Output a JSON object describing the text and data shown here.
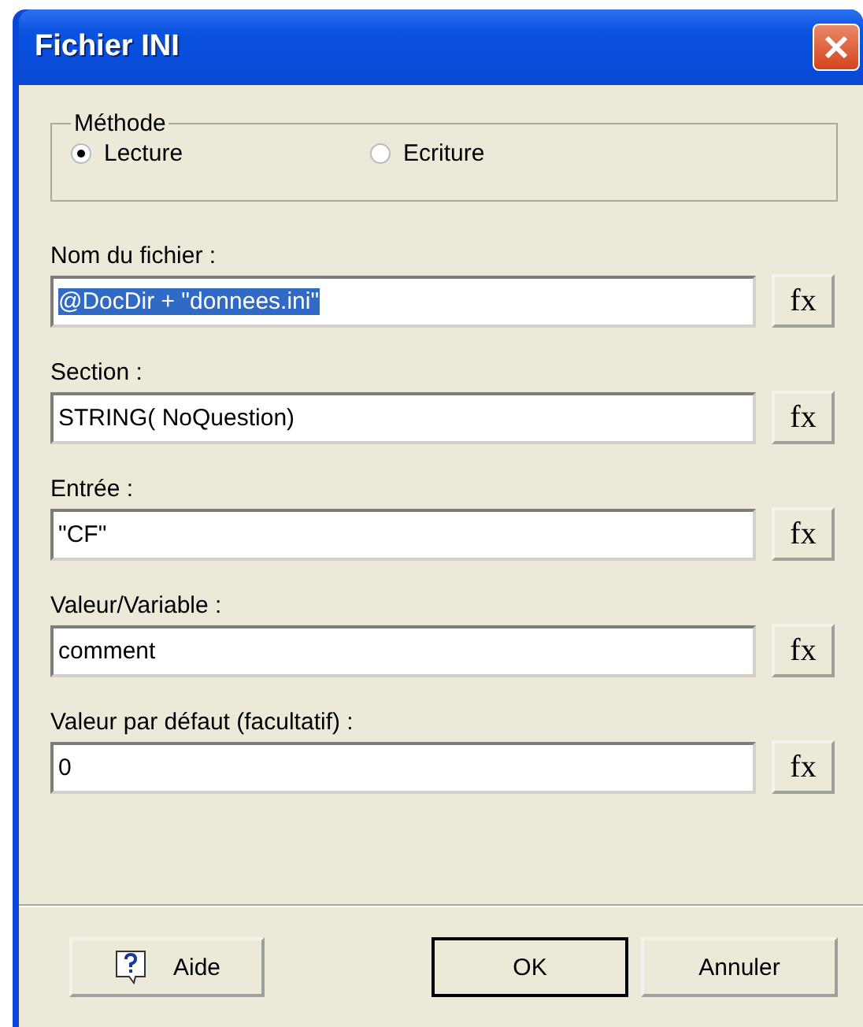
{
  "window": {
    "title": "Fichier INI"
  },
  "method": {
    "legend": "Méthode",
    "options": [
      {
        "label": "Lecture",
        "selected": true
      },
      {
        "label": "Ecriture",
        "selected": false
      }
    ]
  },
  "fields": [
    {
      "label": "Nom du fichier :",
      "value": "@DocDir + \"donnees.ini\"",
      "text_selected": true,
      "button": "fx"
    },
    {
      "label": "Section :",
      "value": "STRING( NoQuestion)",
      "text_selected": false,
      "button": "fx"
    },
    {
      "label": "Entrée :",
      "value": "\"CF\"",
      "text_selected": false,
      "button": "fx"
    },
    {
      "label": "Valeur/Variable :",
      "value": "comment",
      "text_selected": false,
      "button": "fx"
    },
    {
      "label": "Valeur par défaut (facultatif) :",
      "value": "0",
      "text_selected": false,
      "button": "fx"
    }
  ],
  "buttons": [
    {
      "label": "Aide",
      "kind": "help",
      "default": false
    },
    {
      "label": "OK",
      "kind": "plain",
      "default": true
    },
    {
      "label": "Annuler",
      "kind": "plain",
      "default": false
    }
  ]
}
